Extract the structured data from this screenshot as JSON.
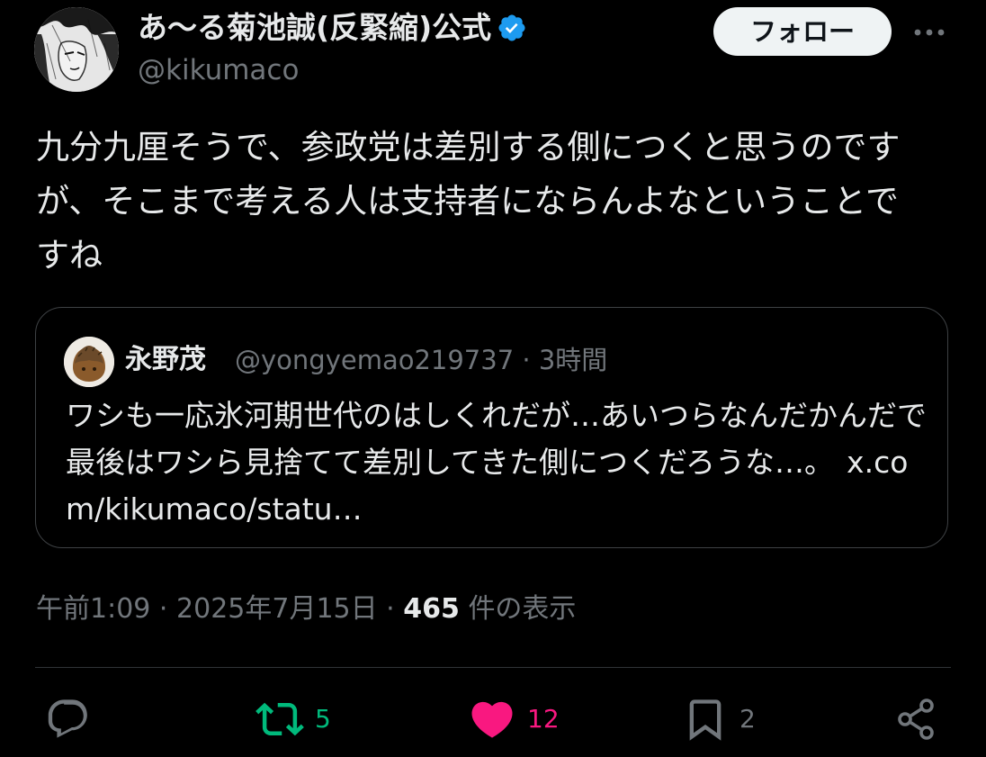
{
  "author": {
    "display_name": "あ〜る菊池誠(反緊縮)公式",
    "handle": "@kikumaco",
    "verified": true,
    "verified_color": "#1d9bf0",
    "avatar_icon": "manga-portrait-avatar"
  },
  "follow_label": "フォロー",
  "more_icon": "more-horizontal-icon",
  "tweet_text": "九分九厘そうで、参政党は差別する側につくと思うのですが、そこまで考える人は支持者にならんよなということですね",
  "quote": {
    "avatar_icon": "chestnut-avatar",
    "name": "永野茂",
    "handle": "@yongyemao219737",
    "separator": "·",
    "time": "3時間",
    "text": "ワシも一応氷河期世代のはしくれだが…あいつらなんだかんだで最後はワシら見捨てて差別してきた側につくだろうな…。",
    "link": "x.com/kikumaco/statu…"
  },
  "meta": {
    "time": "午前1:09",
    "separator": "·",
    "date": "2025年7月15日",
    "views_count": "465",
    "views_label": "件の表示"
  },
  "actions": {
    "reply": {
      "icon": "reply-icon",
      "color": "#71767b"
    },
    "retweet": {
      "icon": "retweet-icon",
      "count": "5",
      "color": "#00ba7c"
    },
    "like": {
      "icon": "heart-icon",
      "count": "12",
      "color": "#f91880",
      "active": true
    },
    "bookmark": {
      "icon": "bookmark-icon",
      "count": "2",
      "color": "#71767b"
    },
    "share": {
      "icon": "share-icon",
      "color": "#71767b"
    }
  }
}
